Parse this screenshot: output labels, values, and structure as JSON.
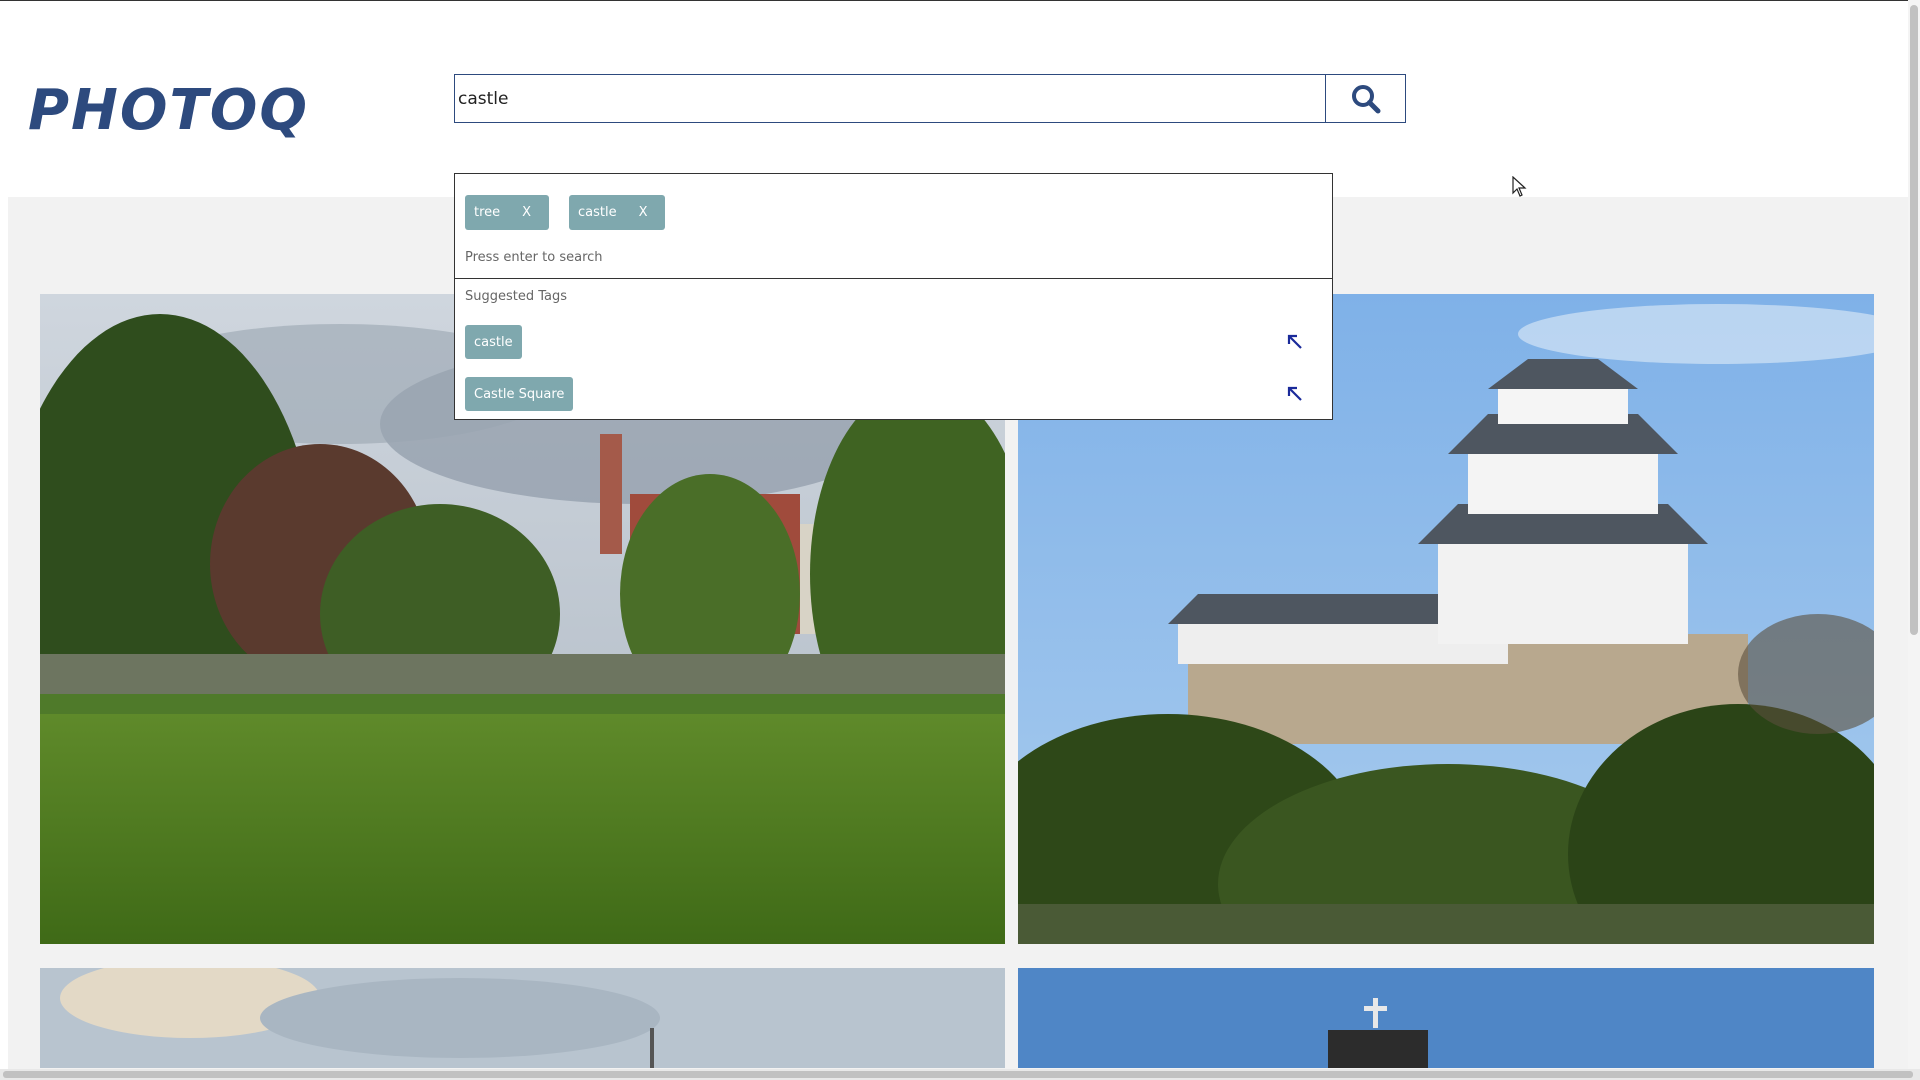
{
  "header": {
    "logo": "PHOTOQ",
    "search_value": "castle",
    "search_button_icon": "search-icon"
  },
  "dropdown": {
    "selected_tags": [
      {
        "label": "tree",
        "remove": "X"
      },
      {
        "label": "castle",
        "remove": "X"
      }
    ],
    "hint": "Press enter to search",
    "suggested_title": "Suggested Tags",
    "suggested_tags": [
      {
        "label": "castle",
        "action_icon": "arrow-up-left-icon"
      },
      {
        "label": "Castle Square",
        "action_icon": "arrow-up-left-icon"
      }
    ]
  },
  "photos": [
    {
      "subject": "park-castle-lake"
    },
    {
      "subject": "japanese-castle"
    },
    {
      "subject": "cloudy-sky-tower"
    },
    {
      "subject": "church-tower-blue-sky"
    }
  ],
  "colors": {
    "brand": "#2d4a7e",
    "tag_chip": "#7fa8ae",
    "gallery_bg": "#f2f2f2"
  }
}
